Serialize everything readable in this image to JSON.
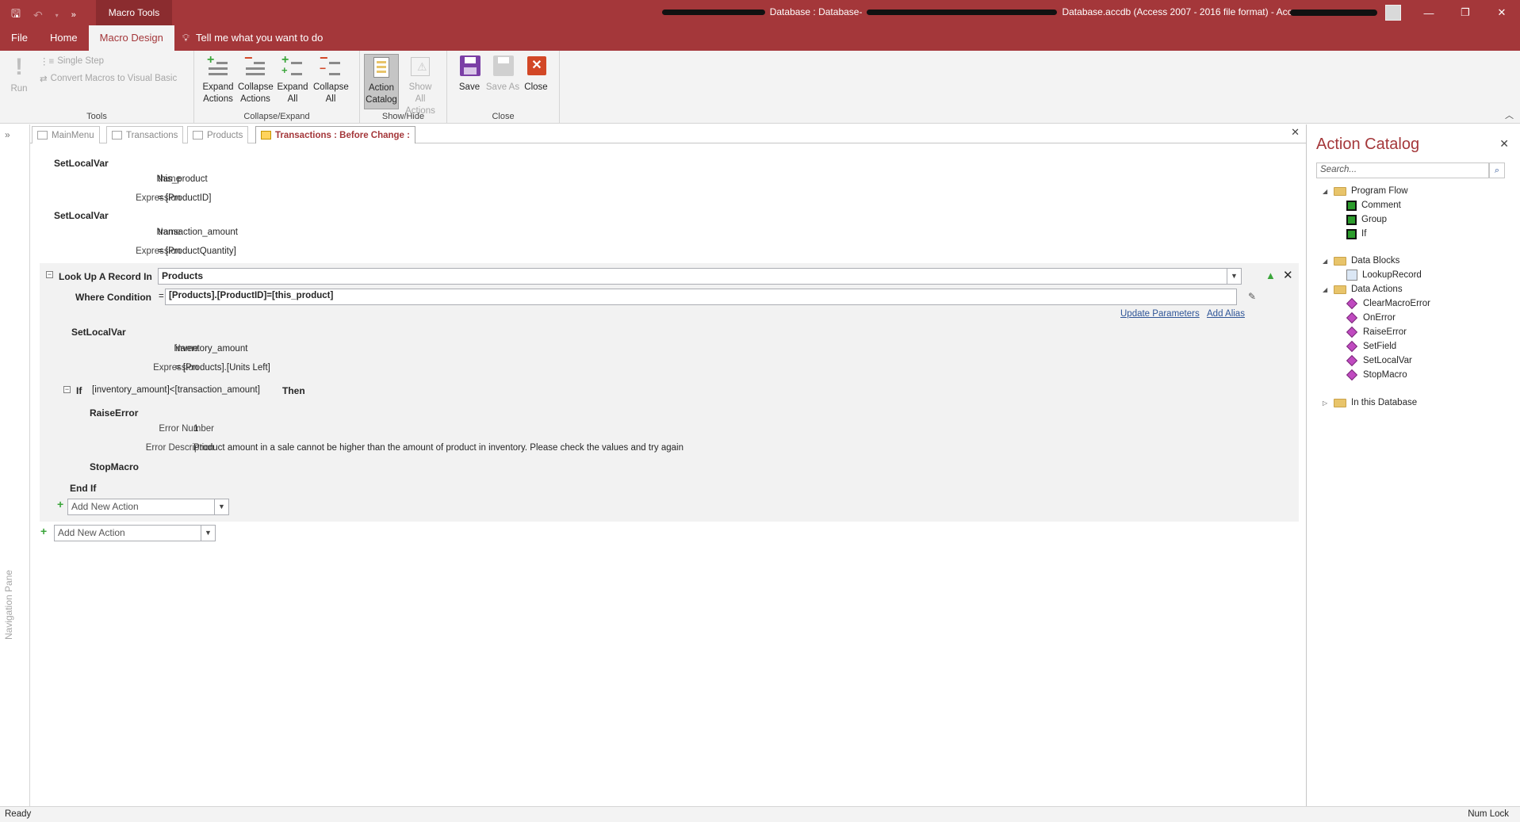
{
  "titlebar": {
    "contextual_tab": "Macro Tools",
    "title_part1": "Database : Database-",
    "title_part2": "Database.accdb (Access 2007 - 2016 file format)  -  Access"
  },
  "ribbon_tabs": {
    "file": "File",
    "home": "Home",
    "macro_design": "Macro Design",
    "tell_me": "Tell me what you want to do"
  },
  "ribbon": {
    "tools": {
      "run": "Run",
      "single_step": "Single Step",
      "convert": "Convert Macros to Visual Basic",
      "label": "Tools"
    },
    "collapse_expand": {
      "expand_actions": "Expand Actions",
      "collapse_actions": "Collapse Actions",
      "expand_all": "Expand All",
      "collapse_all": "Collapse All",
      "label": "Collapse/Expand"
    },
    "show_hide": {
      "action_catalog": "Action Catalog",
      "show_all_actions": "Show All Actions",
      "label": "Show/Hide"
    },
    "close_group": {
      "save": "Save",
      "save_as": "Save As",
      "close": "Close",
      "label": "Close"
    }
  },
  "navpane": {
    "label": "Navigation Pane"
  },
  "doctabs": [
    "MainMenu",
    "Transactions",
    "Products",
    "Transactions : Before Change :"
  ],
  "macro": {
    "setlocal1": {
      "action": "SetLocalVar",
      "name_label": "Name",
      "name_value": "this_product",
      "expr_label": "Expression",
      "expr_value": "= [ProductID]"
    },
    "setlocal2": {
      "action": "SetLocalVar",
      "name_label": "Name",
      "name_value": "transaction_amount",
      "expr_label": "Expression",
      "expr_value": "= [ProductQuantity]"
    },
    "lookup": {
      "label": "Look Up A Record In",
      "table": "Products",
      "where_label": "Where Condition",
      "where_eq": "=",
      "where_value": "[Products].[ProductID]=[this_product]",
      "update_params": "Update Parameters",
      "add_alias": "Add Alias"
    },
    "setlocal3": {
      "action": "SetLocalVar",
      "name_label": "Name",
      "name_value": "inventory_amount",
      "expr_label": "Expression",
      "expr_value": "= [Products].[Units Left]"
    },
    "if_block": {
      "if": "If",
      "condition": "[inventory_amount]<[transaction_amount]",
      "then": "Then",
      "raise": "RaiseError",
      "errnum_label": "Error Number",
      "errnum_value": "1",
      "errdesc_label": "Error Description",
      "errdesc_value": "Product amount in a sale cannot be higher than the amount of product in inventory. Please check the values and try again",
      "stop": "StopMacro",
      "end_if": "End If"
    },
    "add_new_inner": "Add New Action",
    "add_new_outer": "Add New Action"
  },
  "catalog": {
    "title": "Action Catalog",
    "search_placeholder": "Search...",
    "program_flow": "Program Flow",
    "pf_items": [
      "Comment",
      "Group",
      "If"
    ],
    "data_blocks": "Data Blocks",
    "db_items": [
      "LookupRecord"
    ],
    "data_actions": "Data Actions",
    "da_items": [
      "ClearMacroError",
      "OnError",
      "RaiseError",
      "SetField",
      "SetLocalVar",
      "StopMacro"
    ],
    "in_db": "In this Database"
  },
  "status": {
    "left": "Ready",
    "right": "Num Lock"
  },
  "colors": {
    "accent": "#a4373a",
    "link": "#2f5597",
    "green": "#3aa53a"
  }
}
